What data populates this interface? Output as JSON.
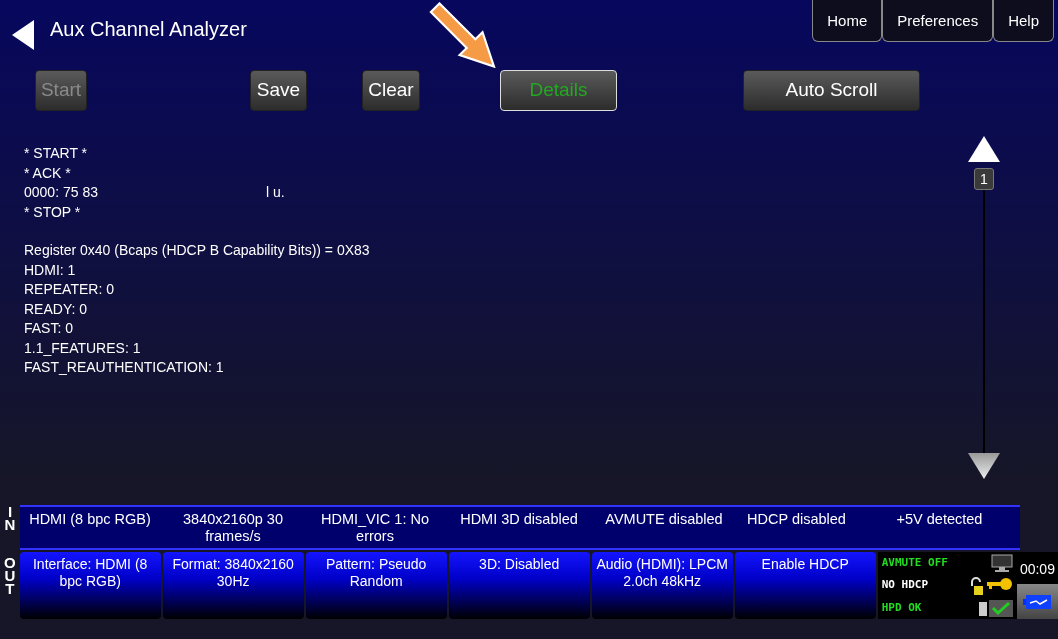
{
  "window": {
    "title": "Aux Channel Analyzer"
  },
  "nav_tabs": [
    {
      "label": "Home"
    },
    {
      "label": "Preferences"
    },
    {
      "label": "Help"
    }
  ],
  "toolbar": [
    {
      "label": "Start",
      "disabled": true,
      "active": false
    },
    {
      "label": "Save",
      "disabled": false,
      "active": false
    },
    {
      "label": "Clear",
      "disabled": false,
      "active": false
    },
    {
      "label": "Details",
      "disabled": false,
      "active": true
    },
    {
      "label": "Auto Scroll",
      "disabled": false,
      "active": false
    }
  ],
  "log_blocks": [
    [
      {
        "text": "* START *"
      },
      {
        "text": "* ACK  *"
      },
      {
        "text": "0000: 75 83",
        "ascii": "l u."
      },
      {
        "text": "* STOP *"
      }
    ],
    [
      {
        "text": "Register 0x40 (Bcaps (HDCP B Capability Bits)) = 0X83"
      },
      {
        "text": "HDMI: 1"
      },
      {
        "text": "REPEATER: 0"
      },
      {
        "text": "READY: 0"
      },
      {
        "text": "FAST: 0"
      },
      {
        "text": "1.1_FEATURES: 1"
      },
      {
        "text": "FAST_REAUTHENTICATION: 1"
      }
    ]
  ],
  "scroll": {
    "page": "1"
  },
  "in_label": "IN",
  "in_status": [
    "HDMI (8 bpc RGB)",
    "3840x2160p 30 frames/s",
    "HDMI_VIC 1: No errors",
    "HDMI 3D disabled",
    "AVMUTE disabled",
    "HDCP disabled",
    "+5V detected"
  ],
  "out_label": "OUT",
  "out_buttons": [
    "Interface: HDMI (8 bpc RGB)",
    "Format: 3840x2160 30Hz",
    "Pattern: Pseudo Random",
    "3D: Disabled",
    "Audio (HDMI): LPCM 2.0ch 48kHz",
    "Enable HDCP"
  ],
  "indicators": [
    {
      "text": "AVMUTE OFF",
      "color": "#22dd22",
      "kind": "monitor"
    },
    {
      "text": "NO HDCP",
      "color": "#ffffff",
      "kind": "lock"
    },
    {
      "text": "HPD OK",
      "color": "#22dd22",
      "kind": "check"
    }
  ],
  "clock": "00:09"
}
